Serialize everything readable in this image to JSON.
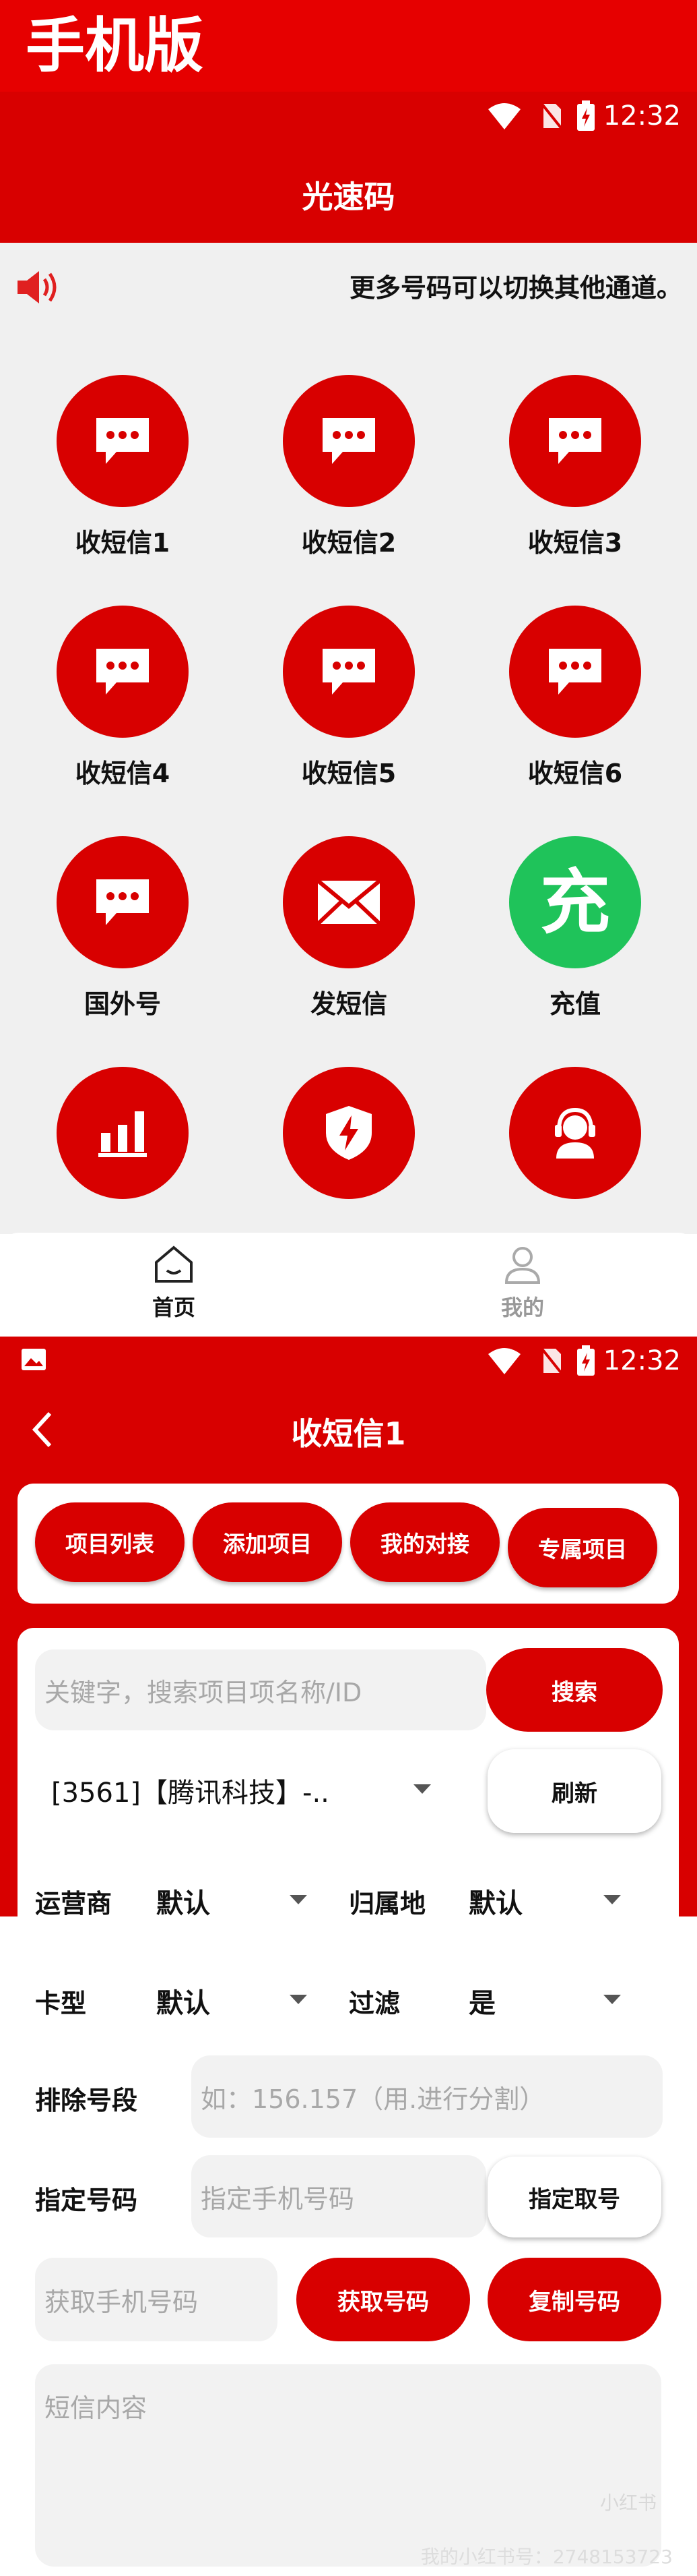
{
  "banner": {
    "title": "手机版"
  },
  "status": {
    "time": "12:32"
  },
  "screen1": {
    "title": "光速码",
    "notice": "更多号码可以切换其他通道。",
    "tiles": [
      {
        "label": "收短信1",
        "icon": "message-icon"
      },
      {
        "label": "收短信2",
        "icon": "message-icon"
      },
      {
        "label": "收短信3",
        "icon": "message-icon"
      },
      {
        "label": "收短信4",
        "icon": "message-icon"
      },
      {
        "label": "收短信5",
        "icon": "message-icon"
      },
      {
        "label": "收短信6",
        "icon": "message-icon"
      },
      {
        "label": "国外号",
        "icon": "message-icon"
      },
      {
        "label": "发短信",
        "icon": "envelope-icon"
      },
      {
        "label": "充值",
        "icon": "recharge-icon",
        "glyph": "充"
      },
      {
        "label": "",
        "icon": "chart-icon"
      },
      {
        "label": "",
        "icon": "shield-bolt-icon"
      },
      {
        "label": "",
        "icon": "support-agent-icon"
      }
    ],
    "nav": {
      "home": "首页",
      "mine": "我的"
    }
  },
  "screen2": {
    "title": "收短信1",
    "tabs": [
      "项目列表",
      "添加项目",
      "我的对接",
      "专属项目"
    ],
    "search": {
      "placeholder": "关键字，搜索项目项名称/ID",
      "button": "搜索"
    },
    "project": {
      "value": "[3561]【腾讯科技】-..",
      "refresh": "刷新"
    },
    "operator": {
      "label": "运营商",
      "value": "默认"
    },
    "region": {
      "label": "归属地",
      "value": "默认"
    },
    "card_type": {
      "label": "卡型",
      "value": "默认"
    },
    "filter": {
      "label": "过滤",
      "value": "是"
    },
    "exclude": {
      "label": "排除号段",
      "placeholder": "如：156.157（用.进行分割）"
    },
    "assign": {
      "label": "指定号码",
      "placeholder": "指定手机号码",
      "button": "指定取号"
    },
    "phone": {
      "placeholder": "获取手机号码",
      "get": "获取号码",
      "copy": "复制号码"
    },
    "sms": {
      "placeholder": "短信内容"
    },
    "watermark": "小红书",
    "watermark_line": "我的小红书号：2748153723"
  },
  "colors": {
    "primary": "#d80000",
    "green": "#1fc35a",
    "background": "#f0f0f0"
  }
}
